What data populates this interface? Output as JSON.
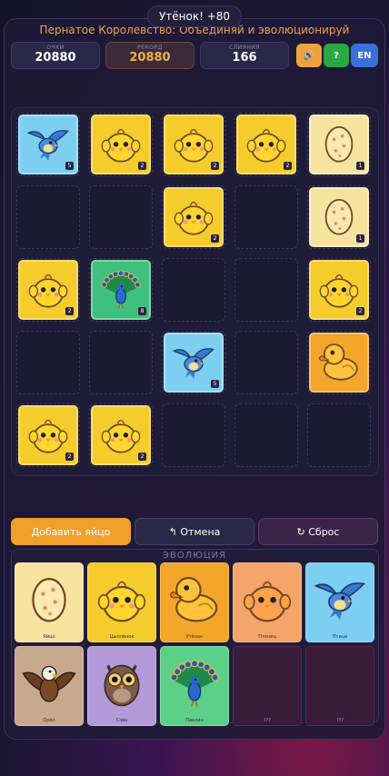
{
  "toast": "Утёнок! +80",
  "subtitle": "Пернатое Королевство: Объединяй и эволюционируй",
  "stats": {
    "score_label": "ОЧКИ",
    "score": "20880",
    "best_label": "РЕКОРД",
    "best": "20880",
    "merges_label": "СЛИЯНИЯ",
    "merges": "166"
  },
  "controls": {
    "sound": "🔊",
    "help": "?",
    "lang": "EN"
  },
  "board": {
    "rows": 5,
    "cols": 5,
    "tiles": [
      {
        "row": 0,
        "col": 0,
        "kind": "bird",
        "level": "5"
      },
      {
        "row": 0,
        "col": 1,
        "kind": "chick",
        "level": "2"
      },
      {
        "row": 0,
        "col": 2,
        "kind": "chick",
        "level": "2"
      },
      {
        "row": 0,
        "col": 3,
        "kind": "chick",
        "level": "2"
      },
      {
        "row": 0,
        "col": 4,
        "kind": "egg",
        "level": "1"
      },
      {
        "row": 1,
        "col": 2,
        "kind": "chick",
        "level": "2"
      },
      {
        "row": 1,
        "col": 4,
        "kind": "egg",
        "level": "1"
      },
      {
        "row": 2,
        "col": 0,
        "kind": "chick",
        "level": "2"
      },
      {
        "row": 2,
        "col": 1,
        "kind": "peacock",
        "level": "8"
      },
      {
        "row": 2,
        "col": 4,
        "kind": "chick",
        "level": "2"
      },
      {
        "row": 3,
        "col": 2,
        "kind": "bird",
        "level": "5"
      },
      {
        "row": 3,
        "col": 4,
        "kind": "duck",
        "level": ""
      },
      {
        "row": 4,
        "col": 0,
        "kind": "chick",
        "level": "2"
      },
      {
        "row": 4,
        "col": 1,
        "kind": "chick",
        "level": "2"
      }
    ]
  },
  "buttons": {
    "add": "Добавить яйцо",
    "undo": "↰ Отмена",
    "reset": "↻ Сброс"
  },
  "evolution": {
    "title": "ЭВОЛЮЦИЯ",
    "cards": [
      {
        "kind": "egg",
        "name": "Яйцо"
      },
      {
        "kind": "chick",
        "name": "Цыплёнок"
      },
      {
        "kind": "duck",
        "name": "Утёнок"
      },
      {
        "kind": "duckling",
        "name": "Птенец"
      },
      {
        "kind": "bird",
        "name": "Птица"
      },
      {
        "kind": "eagle",
        "name": "Орёл"
      },
      {
        "kind": "owl",
        "name": "Сова"
      },
      {
        "kind": "peacock",
        "name": "Павлин"
      },
      {
        "kind": "locked",
        "name": "???"
      },
      {
        "kind": "locked",
        "name": "???"
      }
    ]
  },
  "colors": {
    "accent": "#f0a028",
    "score_best": "#f3b23c",
    "chick": "#f5cc2c",
    "egg": "#f6e3a0",
    "bird": "#7ccff0",
    "peacock": "#3fc07e"
  }
}
